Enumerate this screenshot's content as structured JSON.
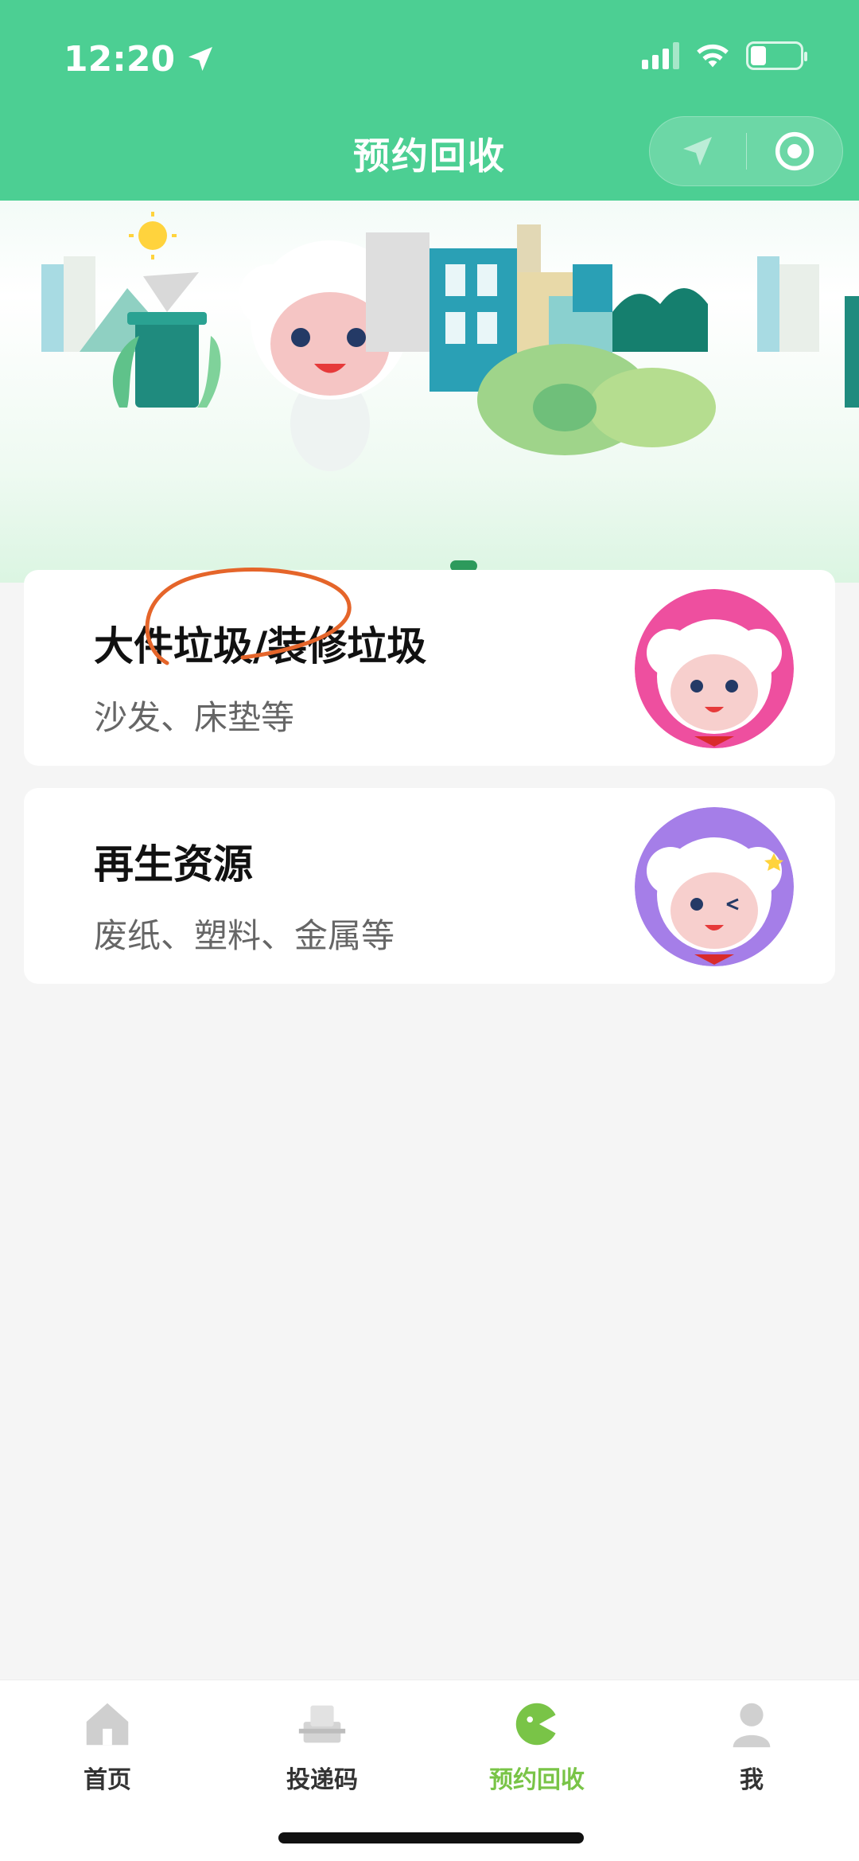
{
  "status_bar": {
    "time": "12:20"
  },
  "header": {
    "title": "预约回收"
  },
  "cards": [
    {
      "title": "大件垃圾/装修垃圾",
      "subtitle": "沙发、床垫等",
      "avatar_color": "#ee4f9f"
    },
    {
      "title": "再生资源",
      "subtitle": "废纸、塑料、金属等",
      "avatar_color": "#a57ee8"
    }
  ],
  "tabs": [
    {
      "label": "首页",
      "icon": "house-icon"
    },
    {
      "label": "投递码",
      "icon": "scan-code-icon"
    },
    {
      "label": "预约回收",
      "icon": "recycle-mascot-icon",
      "active": true
    },
    {
      "label": "我",
      "icon": "user-icon"
    }
  ],
  "colors": {
    "header_green": "#4ccf93",
    "tab_active": "#79c447",
    "annotation": "#e5652a"
  }
}
